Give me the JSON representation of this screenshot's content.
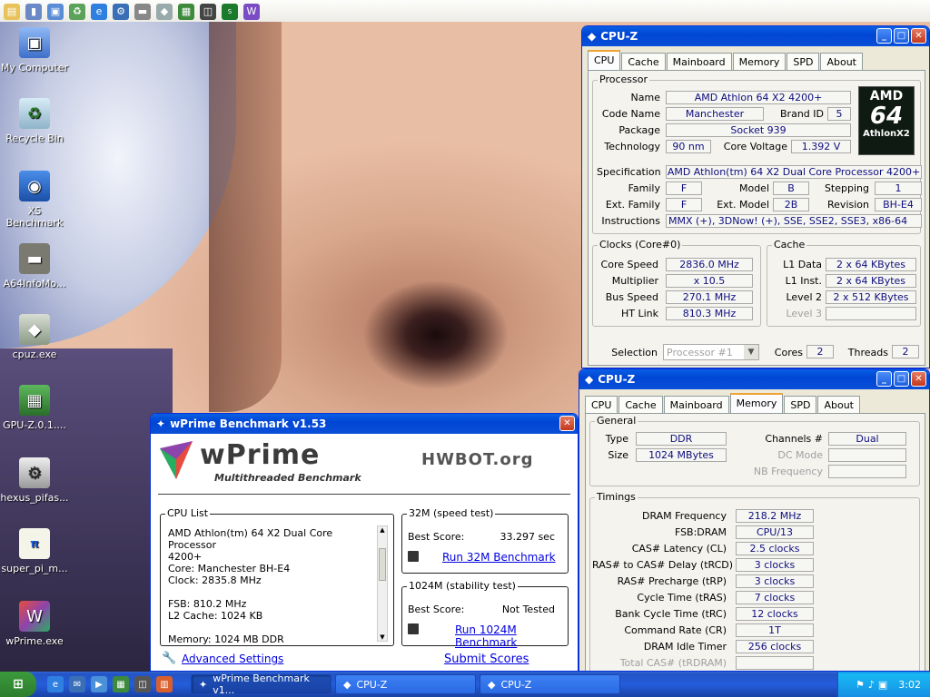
{
  "desktop_icons": [
    {
      "label": "My Computer",
      "icon": "computer-icon"
    },
    {
      "label": "Recycle Bin",
      "icon": "recycle-bin-icon"
    },
    {
      "label": "XS Benchmark",
      "icon": "benchmark-icon"
    },
    {
      "label": "A64InfoMo...",
      "icon": "chip-icon"
    },
    {
      "label": "cpuz.exe",
      "icon": "diamond-icon"
    },
    {
      "label": "GPU-Z.0.1....",
      "icon": "gpu-icon"
    },
    {
      "label": "hexus_pifas...",
      "icon": "program-icon"
    },
    {
      "label": "super_pi_m...",
      "icon": "super-pi-icon"
    },
    {
      "label": "wPrime.exe",
      "icon": "wprime-icon"
    }
  ],
  "cpuz_cpu": {
    "title": "CPU-Z",
    "tabs": [
      "CPU",
      "Cache",
      "Mainboard",
      "Memory",
      "SPD",
      "About"
    ],
    "active_tab": "CPU",
    "processor_label": "Processor",
    "name_label": "Name",
    "name": "AMD Athlon 64 X2 4200+",
    "codename_label": "Code Name",
    "codename": "Manchester",
    "brandid_label": "Brand ID",
    "brandid": "5",
    "package_label": "Package",
    "package": "Socket 939",
    "technology_label": "Technology",
    "technology": "90 nm",
    "voltage_label": "Core Voltage",
    "voltage": "1.392 V",
    "logo_top": "AMD",
    "logo_num": "64",
    "logo_bottom": "AthlonX2",
    "spec_label": "Specification",
    "spec": "AMD Athlon(tm) 64 X2 Dual Core Processor 4200+",
    "family_label": "Family",
    "family": "F",
    "model_label": "Model",
    "model": "B",
    "stepping_label": "Stepping",
    "stepping": "1",
    "extfamily_label": "Ext. Family",
    "extfamily": "F",
    "extmodel_label": "Ext. Model",
    "extmodel": "2B",
    "revision_label": "Revision",
    "revision": "BH-E4",
    "instr_label": "Instructions",
    "instr": "MMX (+), 3DNow! (+), SSE, SSE2, SSE3, x86-64",
    "clocks_label": "Clocks (Core#0)",
    "corespeed_label": "Core Speed",
    "corespeed": "2836.0 MHz",
    "mult_label": "Multiplier",
    "mult": "x 10.5",
    "bus_label": "Bus Speed",
    "bus": "270.1 MHz",
    "ht_label": "HT Link",
    "ht": "810.3 MHz",
    "cache_label": "Cache",
    "l1d_label": "L1 Data",
    "l1d": "2 x 64 KBytes",
    "l1i_label": "L1 Inst.",
    "l1i": "2 x 64 KBytes",
    "l2_label": "Level 2",
    "l2": "2 x 512 KBytes",
    "l3_label": "Level 3",
    "l3": "",
    "selection_label": "Selection",
    "selection": "Processor #1",
    "cores_label": "Cores",
    "cores": "2",
    "threads_label": "Threads",
    "threads": "2"
  },
  "cpuz_mem": {
    "title": "CPU-Z",
    "tabs": [
      "CPU",
      "Cache",
      "Mainboard",
      "Memory",
      "SPD",
      "About"
    ],
    "active_tab": "Memory",
    "general_label": "General",
    "type_label": "Type",
    "type": "DDR",
    "size_label": "Size",
    "size": "1024 MBytes",
    "channels_label": "Channels #",
    "channels": "Dual",
    "dcmode_label": "DC Mode",
    "dcmode": "",
    "nbfreq_label": "NB Frequency",
    "nbfreq": "",
    "timings_label": "Timings",
    "timings": [
      {
        "label": "DRAM Frequency",
        "value": "218.2 MHz",
        "dim": false
      },
      {
        "label": "FSB:DRAM",
        "value": "CPU/13",
        "dim": false
      },
      {
        "label": "CAS# Latency (CL)",
        "value": "2.5 clocks",
        "dim": false
      },
      {
        "label": "RAS# to CAS# Delay (tRCD)",
        "value": "3 clocks",
        "dim": false
      },
      {
        "label": "RAS# Precharge (tRP)",
        "value": "3 clocks",
        "dim": false
      },
      {
        "label": "Cycle Time (tRAS)",
        "value": "7 clocks",
        "dim": false
      },
      {
        "label": "Bank Cycle Time (tRC)",
        "value": "12 clocks",
        "dim": false
      },
      {
        "label": "Command Rate (CR)",
        "value": "1T",
        "dim": false
      },
      {
        "label": "DRAM Idle Timer",
        "value": "256 clocks",
        "dim": false
      },
      {
        "label": "Total CAS# (tRDRAM)",
        "value": "",
        "dim": true
      }
    ]
  },
  "wprime": {
    "title": "wPrime Benchmark v1.53",
    "logo": "wPrime",
    "logo_sub": "Multithreaded Benchmark",
    "hwbot": "HWBOT.org",
    "cpulist_label": "CPU List",
    "cpulist": [
      "AMD Athlon(tm) 64 X2 Dual Core Processor",
      "4200+",
      "Core: Manchester BH-E4",
      "Clock: 2835.8 MHz",
      "",
      "FSB: 810.2 MHz",
      "L2 Cache: 1024 KB",
      "",
      "Memory: 1024 MB DDR"
    ],
    "t32_label": "32M (speed test)",
    "t32_best_label": "Best Score:",
    "t32_best": "33.297 sec",
    "t32_run": "Run 32M Benchmark",
    "t1024_label": "1024M (stability test)",
    "t1024_best_label": "Best Score:",
    "t1024_best": "Not Tested",
    "t1024_run": "Run 1024M Benchmark",
    "advanced": "Advanced Settings",
    "submit": "Submit Scores"
  },
  "taskbar": {
    "start": "⊞",
    "buttons": [
      "wPrime Benchmark v1...",
      "CPU-Z",
      "CPU-Z"
    ],
    "clock": "3:02"
  },
  "colors": {
    "xp_blue": "#0a5fe4",
    "tab_accent": "#f0a232",
    "value_text": "#0e0e7f",
    "link": "#0000e0"
  }
}
